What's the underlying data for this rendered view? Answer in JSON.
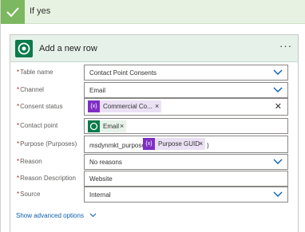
{
  "condition": {
    "label": "If yes"
  },
  "action": {
    "title": "Add a new row",
    "more": "···"
  },
  "fields": [
    {
      "label": "Table name",
      "value": "Contact Point Consents"
    },
    {
      "label": "Channel",
      "value": "Email"
    },
    {
      "label": "Consent status",
      "token": "Commercial Co..."
    },
    {
      "label": "Contact point",
      "token": "Email"
    },
    {
      "label": "Purpose (Purposes)",
      "prefix": "msdynmkt_purposes(",
      "token": "Purpose GUID",
      "suffix": ")"
    },
    {
      "label": "Reason",
      "value": "No reasons"
    },
    {
      "label": "Reason Description",
      "value": "Website"
    },
    {
      "label": "Source",
      "value": "Internal"
    }
  ],
  "advanced": {
    "label": "Show advanced options"
  },
  "colors": {
    "accent_green": "#0b7a4b",
    "condition_green": "#7cb85f",
    "token_purple": "#7f2fc4",
    "link_blue": "#0a5fb0",
    "chevron_blue": "#0a5fb0"
  }
}
